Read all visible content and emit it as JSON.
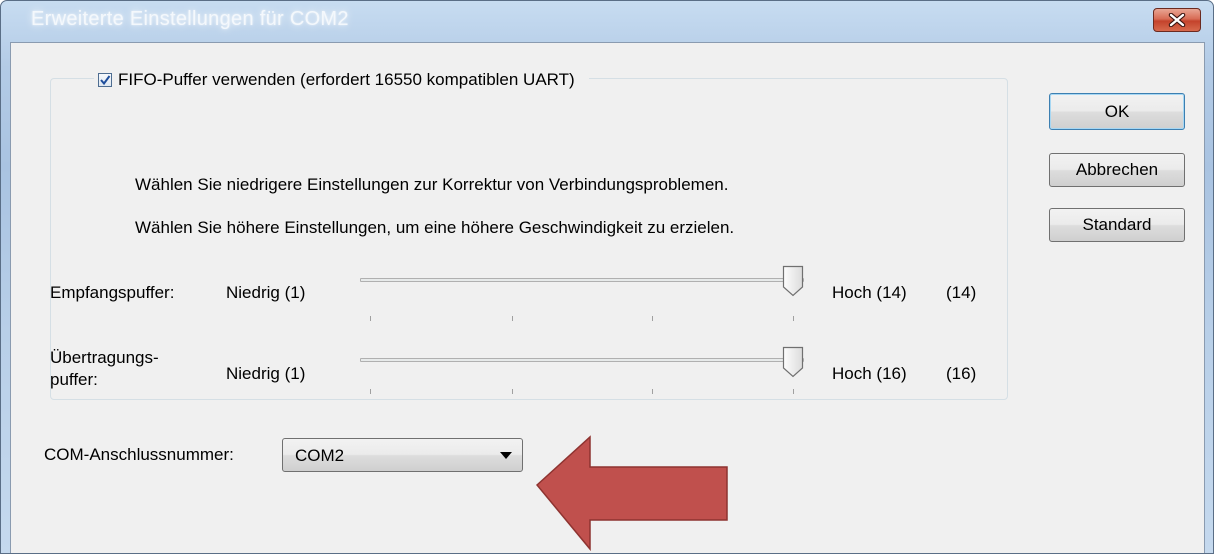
{
  "window": {
    "title": "Erweiterte Einstellungen für COM2",
    "close_icon": "close-icon"
  },
  "fifo": {
    "checkbox_label": "FIFO-Puffer verwenden (erfordert 16550 kompatiblen UART)",
    "checked": true
  },
  "hints": {
    "lower": "Wählen Sie niedrigere Einstellungen zur Korrektur von Verbindungsproblemen.",
    "higher": "Wählen Sie höhere Einstellungen, um eine höhere Geschwindigkeit zu erzielen."
  },
  "receive_buffer": {
    "label": "Empfangspuffer:",
    "min_label": "Niedrig (1)",
    "max_label": "Hoch (14)",
    "current_display": "(14)",
    "value": 14,
    "min": 1,
    "max": 14
  },
  "transmit_buffer": {
    "label_line1": "Übertragungs-",
    "label_line2": "puffer:",
    "min_label": "Niedrig (1)",
    "max_label": "Hoch (16)",
    "current_display": "(16)",
    "value": 16,
    "min": 1,
    "max": 16
  },
  "com_port": {
    "label": "COM-Anschlussnummer:",
    "selected": "COM2"
  },
  "buttons": {
    "ok": "OK",
    "cancel": "Abbrechen",
    "default": "Standard"
  },
  "colors": {
    "annotation_arrow": "#c0504d",
    "close_button": "#c4432c"
  }
}
